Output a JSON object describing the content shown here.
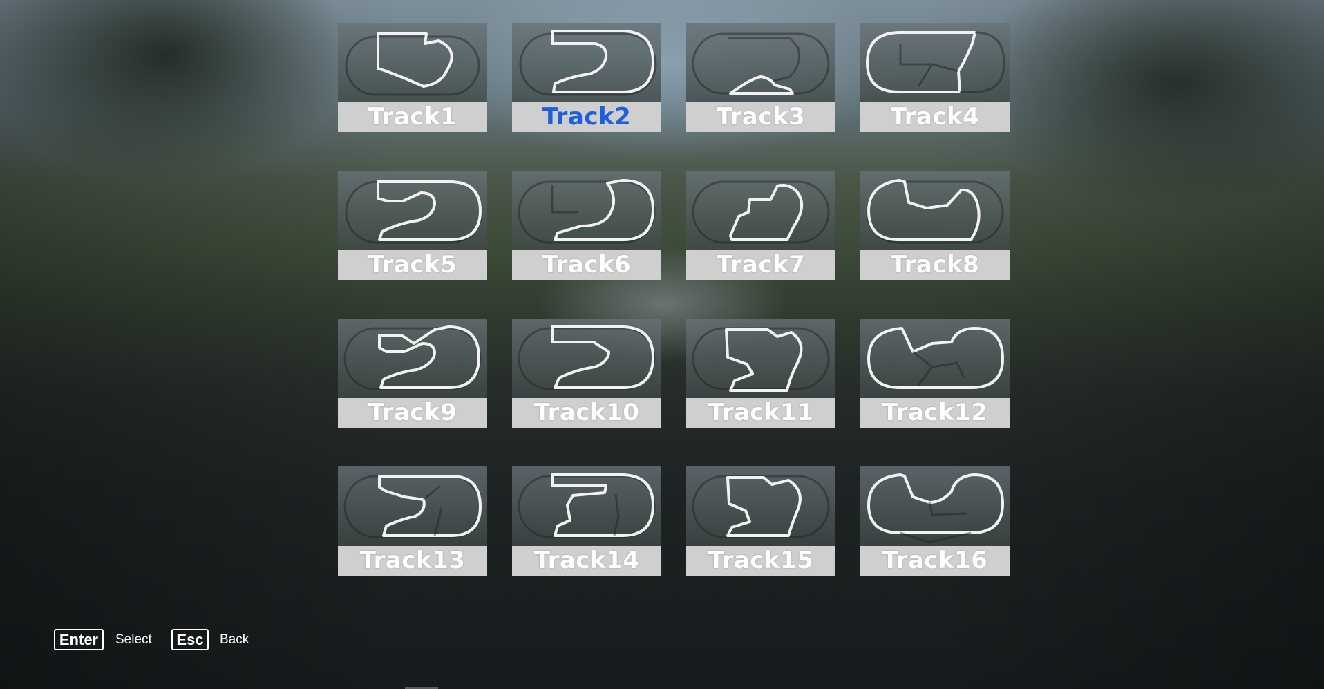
{
  "selected_track": "Track2",
  "colors": {
    "selected_label": "#1f5fdc",
    "label_text": "#ffffff",
    "label_bg": "#cfcfcf"
  },
  "tracks": [
    {
      "label": "Track1"
    },
    {
      "label": "Track2"
    },
    {
      "label": "Track3"
    },
    {
      "label": "Track4"
    },
    {
      "label": "Track5"
    },
    {
      "label": "Track6"
    },
    {
      "label": "Track7"
    },
    {
      "label": "Track8"
    },
    {
      "label": "Track9"
    },
    {
      "label": "Track10"
    },
    {
      "label": "Track11"
    },
    {
      "label": "Track12"
    },
    {
      "label": "Track13"
    },
    {
      "label": "Track14"
    },
    {
      "label": "Track15"
    },
    {
      "label": "Track16"
    }
  ],
  "hints": {
    "enter_key": "Enter",
    "enter_action": "Select",
    "esc_key": "Esc",
    "esc_action": "Back"
  }
}
